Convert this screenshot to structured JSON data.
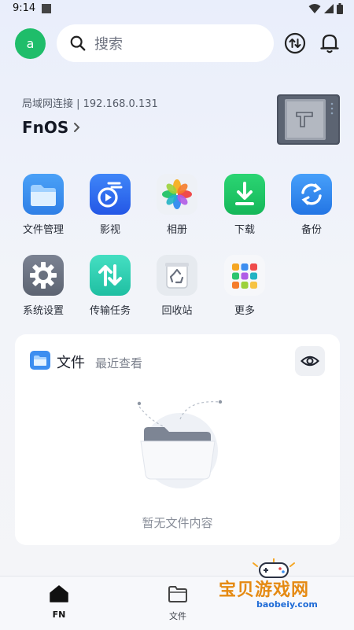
{
  "status_bar": {
    "time": "9:14"
  },
  "header": {
    "avatar_letter": "a",
    "search_placeholder": "搜索"
  },
  "device": {
    "lan_info": "局域网连接 | 192.168.0.131",
    "name": "FnOS"
  },
  "apps": [
    {
      "label": "文件管理",
      "icon": "folder-icon"
    },
    {
      "label": "影视",
      "icon": "video-icon"
    },
    {
      "label": "相册",
      "icon": "photos-icon"
    },
    {
      "label": "下载",
      "icon": "download-icon"
    },
    {
      "label": "备份",
      "icon": "backup-icon"
    },
    {
      "label": "系统设置",
      "icon": "settings-gear-icon"
    },
    {
      "label": "传输任务",
      "icon": "transfer-tasks-icon"
    },
    {
      "label": "回收站",
      "icon": "recycle-bin-icon"
    },
    {
      "label": "更多",
      "icon": "more-apps-icon"
    }
  ],
  "files_card": {
    "title": "文件",
    "subtitle": "最近查看",
    "empty_text": "暂无文件内容"
  },
  "bottom_nav": [
    {
      "label": "FN",
      "icon": "home-icon",
      "active": true
    },
    {
      "label": "文件",
      "icon": "folder-outline-icon",
      "active": false
    }
  ],
  "watermark": {
    "main": "宝贝游戏网",
    "sub": "baobeiy.com"
  },
  "colors": {
    "avatar": "#1fbd6a",
    "files_blue": "#3d8ef0",
    "video_blue": "#2f6df0",
    "download_green": "#19c463",
    "backup_blue": "#2b86ee",
    "settings_grey": "#6d7482",
    "transfer_teal": "#33d0b3"
  }
}
